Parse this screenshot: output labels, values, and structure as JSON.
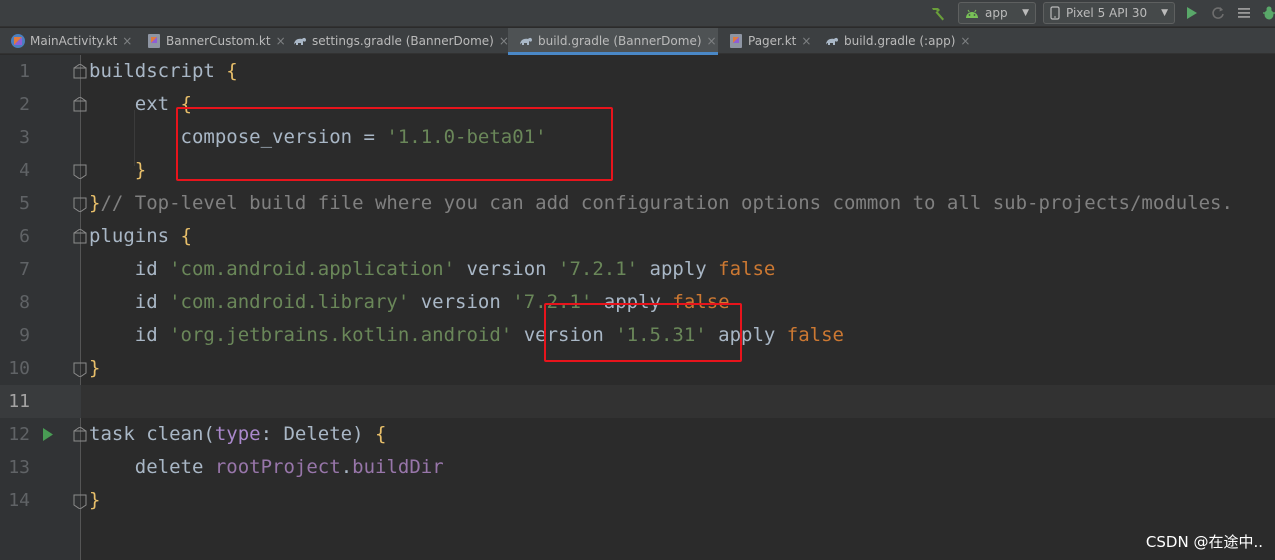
{
  "toolbar": {
    "run_config": "app",
    "device": "Pixel 5 API 30",
    "icons": [
      "hammer-icon",
      "android-icon",
      "phone-icon",
      "run-icon",
      "rerun-icon",
      "sync-icon",
      "debug-icon"
    ]
  },
  "tabs": [
    {
      "label": "MainActivity.kt",
      "icon": "kotlin-icon",
      "active": false
    },
    {
      "label": "BannerCustom.kt",
      "icon": "kotlin-class-icon",
      "active": false
    },
    {
      "label": "settings.gradle (BannerDome)",
      "icon": "gradle-icon",
      "active": false
    },
    {
      "label": "build.gradle (BannerDome)",
      "icon": "gradle-icon",
      "active": true
    },
    {
      "label": "Pager.kt",
      "icon": "kotlin-class-icon",
      "active": false
    },
    {
      "label": "build.gradle (:app)",
      "icon": "gradle-icon",
      "active": false
    }
  ],
  "tab_close": "×",
  "editor": {
    "current_line": 11,
    "lines": [
      {
        "n": "1",
        "t": [
          [
            "t-default",
            "buildscript "
          ],
          [
            "t-brace",
            "{"
          ]
        ]
      },
      {
        "n": "2",
        "t": [
          [
            "t-default",
            "    ext "
          ],
          [
            "t-brace",
            "{"
          ]
        ]
      },
      {
        "n": "3",
        "t": [
          [
            "t-default",
            "        compose_version = "
          ],
          [
            "t-str",
            "'1.1.0-beta01'"
          ]
        ]
      },
      {
        "n": "4",
        "t": [
          [
            "t-brace",
            "    }"
          ]
        ]
      },
      {
        "n": "5",
        "t": [
          [
            "t-brace",
            "}"
          ],
          [
            "t-comment",
            "// Top-level build file where you can add configuration options common to all sub-projects/modules."
          ]
        ]
      },
      {
        "n": "6",
        "t": [
          [
            "t-default",
            "plugins "
          ],
          [
            "t-brace",
            "{"
          ]
        ]
      },
      {
        "n": "7",
        "t": [
          [
            "t-default",
            "    id "
          ],
          [
            "t-str",
            "'com.android.application'"
          ],
          [
            "t-default",
            " version "
          ],
          [
            "t-str",
            "'7.2.1'"
          ],
          [
            "t-default",
            " apply "
          ],
          [
            "t-kw",
            "false"
          ]
        ]
      },
      {
        "n": "8",
        "t": [
          [
            "t-default",
            "    id "
          ],
          [
            "t-str",
            "'com.android.library'"
          ],
          [
            "t-default",
            " version "
          ],
          [
            "t-str",
            "'7.2.1'"
          ],
          [
            "t-default",
            " apply "
          ],
          [
            "t-kw",
            "false"
          ]
        ]
      },
      {
        "n": "9",
        "t": [
          [
            "t-default",
            "    id "
          ],
          [
            "t-str",
            "'org.jetbrains.kotlin.android'"
          ],
          [
            "t-default",
            " version "
          ],
          [
            "t-str",
            "'1.5.31'"
          ],
          [
            "t-default",
            " apply "
          ],
          [
            "t-kw",
            "false"
          ]
        ]
      },
      {
        "n": "10",
        "t": [
          [
            "t-brace",
            "}"
          ]
        ]
      },
      {
        "n": "11",
        "t": []
      },
      {
        "n": "12",
        "t": [
          [
            "t-default",
            "task clean("
          ],
          [
            "t-param",
            "type"
          ],
          [
            "t-default",
            ": Delete) "
          ],
          [
            "t-brace",
            "{"
          ]
        ]
      },
      {
        "n": "13",
        "t": [
          [
            "t-default",
            "    delete "
          ],
          [
            "t-prop",
            "rootProject"
          ],
          [
            "t-default",
            "."
          ],
          [
            "t-prop",
            "buildDir"
          ]
        ]
      },
      {
        "n": "14",
        "t": [
          [
            "t-brace",
            "}"
          ]
        ]
      }
    ]
  },
  "annotations": [
    "compose-version-highlight",
    "kotlin-version-highlight"
  ],
  "watermark": "CSDN @在途中..",
  "colors": {
    "highlight": "#e8141c",
    "accent": "#4a88c7",
    "string": "#6a8759",
    "keyword": "#cc7832",
    "brace": "#e8bf6a"
  }
}
